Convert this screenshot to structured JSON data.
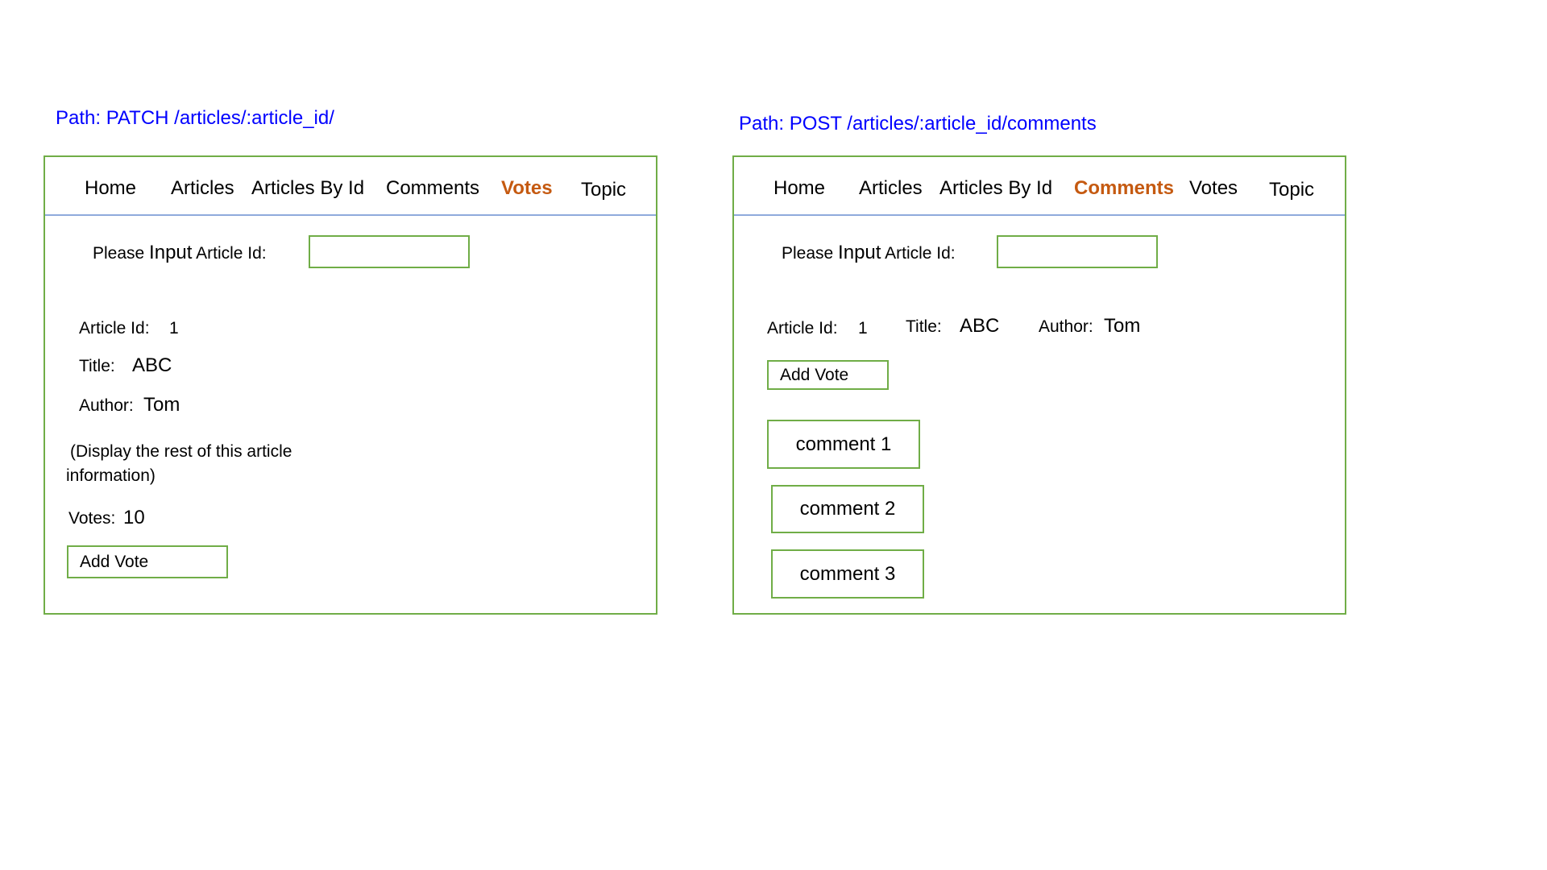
{
  "left": {
    "path": "Path: PATCH /articles/:article_id/",
    "nav": [
      "Home",
      "Articles",
      "Articles By Id",
      "Comments",
      "Votes",
      "Topic"
    ],
    "active_nav": "Votes",
    "input_label_pre": "Please ",
    "input_label_mid": "Input",
    "input_label_post": " Article Id:",
    "input_value": "",
    "article_id_label": "Article Id:",
    "article_id": "1",
    "title_label": "Title:",
    "title": "ABC",
    "author_label": "Author:",
    "author": "Tom",
    "note_line1": "(Display the rest of  this article",
    "note_line2": "information)",
    "votes_label": "Votes:",
    "votes": "10",
    "add_vote": "Add Vote"
  },
  "right": {
    "path": "Path: POST /articles/:article_id/comments",
    "nav": [
      "Home",
      "Articles",
      "Articles By Id",
      "Comments",
      "Votes",
      "Topic"
    ],
    "active_nav": "Comments",
    "input_label_pre": "Please ",
    "input_label_mid": "Input",
    "input_label_post": " Article Id:",
    "input_value": "",
    "article_id_label": "Article Id:",
    "article_id": "1",
    "title_label": "Title:",
    "title": "ABC",
    "author_label": "Author:",
    "author": "Tom",
    "add_vote": "Add Vote",
    "comments": [
      "comment 1",
      "comment 2",
      "comment 3"
    ]
  },
  "colors": {
    "accent": "#c55a11",
    "border": "#70ad47",
    "path": "#0000ff",
    "divider": "#8faadc"
  }
}
